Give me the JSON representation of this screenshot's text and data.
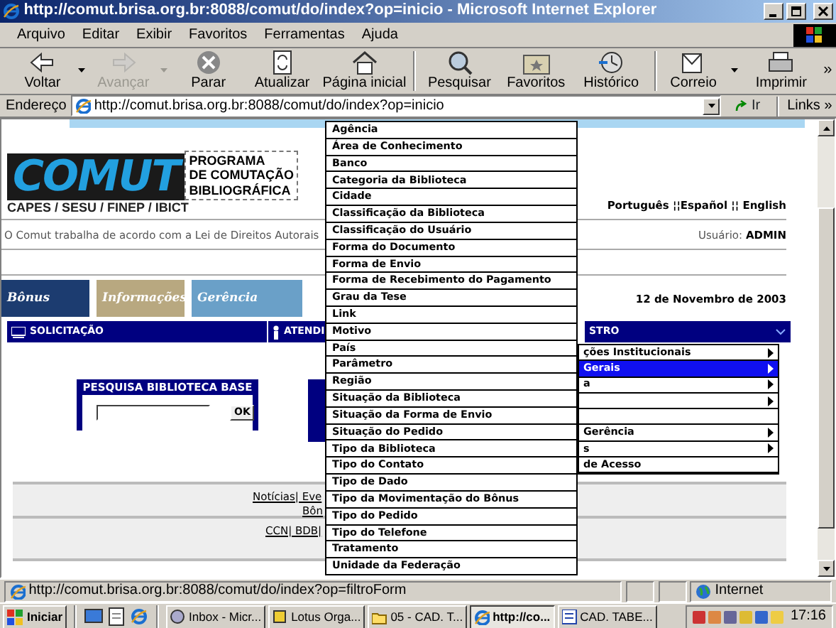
{
  "window": {
    "title": "http://comut.brisa.org.br:8088/comut/do/index?op=inicio - Microsoft Internet Explorer"
  },
  "menu_bar": [
    "Arquivo",
    "Editar",
    "Exibir",
    "Favoritos",
    "Ferramentas",
    "Ajuda"
  ],
  "toolbar": [
    {
      "label": "Voltar",
      "disabled": false,
      "dropdown": true
    },
    {
      "label": "Avançar",
      "disabled": true,
      "dropdown": true
    },
    {
      "label": "Parar",
      "disabled": false,
      "dropdown": false
    },
    {
      "label": "Atualizar",
      "disabled": false,
      "dropdown": false
    },
    {
      "label": "Página inicial",
      "disabled": false,
      "dropdown": false
    },
    {
      "label": "Pesquisar",
      "disabled": false,
      "dropdown": false
    },
    {
      "label": "Favoritos",
      "disabled": false,
      "dropdown": false
    },
    {
      "label": "Histórico",
      "disabled": false,
      "dropdown": false
    },
    {
      "label": "Correio",
      "disabled": false,
      "dropdown": true
    },
    {
      "label": "Imprimir",
      "disabled": false,
      "dropdown": false
    }
  ],
  "toolbar_overflow": "»",
  "address_bar": {
    "label": "Endereço",
    "url": "http://comut.brisa.org.br:8088/comut/do/index?op=inicio",
    "go": "Ir",
    "links": "Links",
    "overflow": "»"
  },
  "page": {
    "logo": {
      "mark": "COMUT",
      "lines": [
        "PROGRAMA",
        "DE COMUTAÇÃO",
        "BIBLIOGRÁFICA"
      ],
      "caption": "CAPES / SESU / FINEP / IBICT"
    },
    "languages": "Português ¦¦Español ¦¦ English",
    "notice": "O Comut trabalha de acordo com a Lei de Direitos Autorais",
    "user": {
      "label": "Usuário:",
      "name": "ADMIN"
    },
    "banners": [
      "Bônus",
      "Informações",
      "Gerência"
    ],
    "date": "12 de Novembro de 2003",
    "nav": [
      {
        "label": "SOLICITAÇÃO"
      },
      {
        "label": "ATENDI"
      },
      {
        "label": "STRO",
        "expanded": true
      }
    ],
    "search_panel": {
      "title": "PESQUISA BIBLIOTECA BASE",
      "button": "OK"
    },
    "footer_rows": [
      [
        "Notícias| Eve",
        "Bôn"
      ],
      [
        "CCN| BDB|"
      ]
    ]
  },
  "submenu": [
    {
      "label": "ções Institucionais",
      "selected": false,
      "has_submenu": true
    },
    {
      "label": "Gerais",
      "selected": true,
      "has_submenu": true
    },
    {
      "label": "a",
      "selected": false,
      "has_submenu": true
    },
    {
      "selected": false,
      "has_submenu": true
    },
    {
      "selected": false,
      "has_submenu": false
    },
    {
      "label": "Gerência",
      "selected": false,
      "has_submenu": true
    },
    {
      "label": "s",
      "selected": false,
      "has_submenu": true
    },
    {
      "label": "de Acesso",
      "selected": false,
      "has_submenu": false
    }
  ],
  "dropdown": [
    "Agência",
    "Área de Conhecimento",
    "Banco",
    "Categoria da Biblioteca",
    "Cidade",
    "Classificação da Biblioteca",
    "Classificação do Usuário",
    "Forma do Documento",
    "Forma de Envio",
    "Forma de Recebimento do Pagamento",
    "Grau da Tese",
    "Link",
    "Motivo",
    "País",
    "Parâmetro",
    "Região",
    "Situação da Biblioteca",
    "Situação da Forma de Envio",
    "Situação do Pedido",
    "Tipo da Biblioteca",
    "Tipo do Contato",
    "Tipo de Dado",
    "Tipo da Movimentação do Bônus",
    "Tipo do Pedido",
    "Tipo do Telefone",
    "Tratamento",
    "Unidade da Federação"
  ],
  "status_bar": {
    "url": "http://comut.brisa.org.br:8088/comut/do/index?op=filtroForm",
    "zone": "Internet"
  },
  "taskbar": {
    "start": "Iniciar",
    "tasks": [
      {
        "label": "Inbox - Micr...",
        "selected": false
      },
      {
        "label": "Lotus Orga...",
        "selected": false
      },
      {
        "label": "05 - CAD. T...",
        "selected": false
      },
      {
        "label": "http://co...",
        "selected": true
      },
      {
        "label": "CAD. TABE...",
        "selected": false
      }
    ],
    "clock": "17:16"
  }
}
